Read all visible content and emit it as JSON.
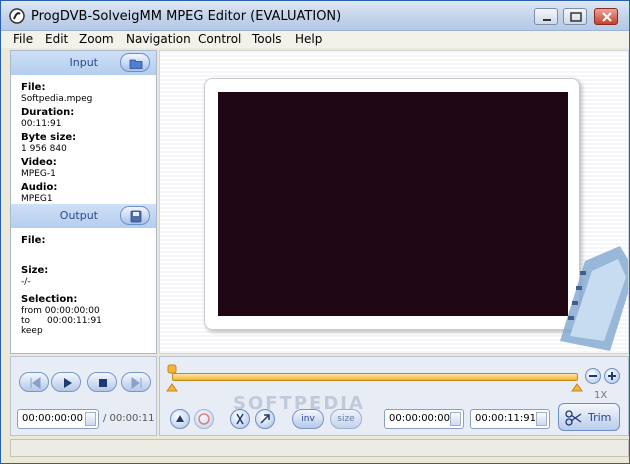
{
  "window": {
    "title": "ProgDVB-SolveigMM MPEG Editor  (EVALUATION)"
  },
  "menu": [
    "File",
    "Edit",
    "Zoom",
    "Navigation",
    "Control",
    "Tools",
    "Help"
  ],
  "input_panel": {
    "header": "Input",
    "file_label": "File:",
    "file_value": "Softpedia.mpeg",
    "duration_label": "Duration:",
    "duration_value": "00:11:91",
    "byte_size_label": "Byte size:",
    "byte_size_value": "1 956 840",
    "video_label": "Video:",
    "video_value": "MPEG-1",
    "audio_label": "Audio:",
    "audio_value": "MPEG1"
  },
  "output_panel": {
    "header": "Output",
    "file_label": "File:",
    "size_label": "Size:",
    "size_value": "-/-",
    "selection_label": "Selection:",
    "selection_from": "from 00:00:00:00",
    "selection_to_label": "to",
    "selection_to_value": "00:00:11:91",
    "selection_mode": "keep"
  },
  "playback": {
    "current_time": "00:00:00:00",
    "total_time": "/ 00:00:11"
  },
  "timeline": {
    "speed": "1X",
    "sel_start": "00:00:00:00",
    "sel_end": "00:00:11:91",
    "inv_label": "inv",
    "size_label": "size",
    "trim_label": "Trim"
  },
  "watermark": "SOFTPEDIA",
  "colors": {
    "accent": "#2c4a8a",
    "timeline": "#f6b23a",
    "screen": "#1e0612"
  }
}
